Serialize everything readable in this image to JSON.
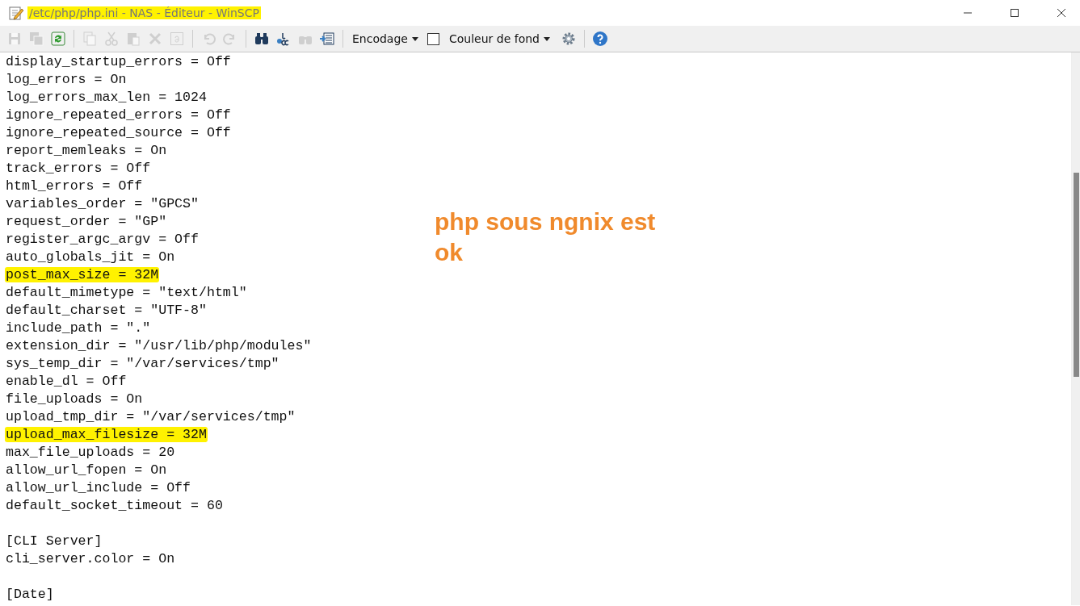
{
  "window": {
    "title": "/etc/php/php.ini - NAS - Éditeur - WinSCP",
    "title_highlighted": true
  },
  "toolbar": [
    {
      "kind": "icon",
      "disabled": true
    },
    {
      "kind": "icon",
      "disabled": true
    },
    {
      "kind": "icon",
      "disabled": false
    },
    {
      "kind": "separator"
    },
    {
      "kind": "icon",
      "disabled": true
    },
    {
      "kind": "icon",
      "disabled": true
    },
    {
      "kind": "icon",
      "disabled": true
    },
    {
      "kind": "icon",
      "disabled": true
    },
    {
      "kind": "icon",
      "disabled": true
    },
    {
      "kind": "separator"
    },
    {
      "kind": "icon",
      "disabled": true
    },
    {
      "kind": "icon",
      "disabled": true
    },
    {
      "kind": "separator"
    },
    {
      "kind": "icon",
      "disabled": false
    },
    {
      "kind": "icon",
      "disabled": false
    },
    {
      "kind": "icon",
      "disabled": true
    },
    {
      "kind": "icon",
      "disabled": false
    },
    {
      "kind": "separator"
    },
    {
      "kind": "dropdown",
      "label": "Encodage"
    },
    {
      "kind": "checkbox",
      "label": "Couleur de fond",
      "checked": false
    },
    {
      "kind": "icon",
      "disabled": false
    },
    {
      "kind": "separator"
    },
    {
      "kind": "icon",
      "disabled": false
    }
  ],
  "lines": [
    {
      "kind": "code",
      "text": "display_startup_errors = Off",
      "highlighted": false
    },
    {
      "kind": "code",
      "text": "log_errors = On",
      "highlighted": false
    },
    {
      "kind": "code",
      "text": "log_errors_max_len = 1024",
      "highlighted": false
    },
    {
      "kind": "code",
      "text": "ignore_repeated_errors = Off",
      "highlighted": false
    },
    {
      "kind": "code",
      "text": "ignore_repeated_source = Off",
      "highlighted": false
    },
    {
      "kind": "code",
      "text": "report_memleaks = On",
      "highlighted": false
    },
    {
      "kind": "code",
      "text": "track_errors = Off",
      "highlighted": false
    },
    {
      "kind": "code",
      "text": "html_errors = Off",
      "highlighted": false
    },
    {
      "kind": "code",
      "text": "variables_order = \"GPCS\"",
      "highlighted": false
    },
    {
      "kind": "code",
      "text": "request_order = \"GP\"",
      "highlighted": false
    },
    {
      "kind": "code",
      "text": "register_argc_argv = Off",
      "highlighted": false
    },
    {
      "kind": "code",
      "text": "auto_globals_jit = On",
      "highlighted": false
    },
    {
      "kind": "code",
      "text": "post_max_size = 32M",
      "highlighted": true
    },
    {
      "kind": "code",
      "text": "default_mimetype = \"text/html\"",
      "highlighted": false
    },
    {
      "kind": "code",
      "text": "default_charset = \"UTF-8\"",
      "highlighted": false
    },
    {
      "kind": "code",
      "text": "include_path = \".\"",
      "highlighted": false
    },
    {
      "kind": "code",
      "text": "extension_dir = \"/usr/lib/php/modules\"",
      "highlighted": false
    },
    {
      "kind": "code",
      "text": "sys_temp_dir = \"/var/services/tmp\"",
      "highlighted": false
    },
    {
      "kind": "code",
      "text": "enable_dl = Off",
      "highlighted": false
    },
    {
      "kind": "code",
      "text": "file_uploads = On",
      "highlighted": false
    },
    {
      "kind": "code",
      "text": "upload_tmp_dir = \"/var/services/tmp\"",
      "highlighted": false
    },
    {
      "kind": "code",
      "text": "upload_max_filesize = 32M",
      "highlighted": true
    },
    {
      "kind": "code",
      "text": "max_file_uploads = 20",
      "highlighted": false
    },
    {
      "kind": "code",
      "text": "allow_url_fopen = On",
      "highlighted": false
    },
    {
      "kind": "code",
      "text": "allow_url_include = Off",
      "highlighted": false
    },
    {
      "kind": "code",
      "text": "default_socket_timeout = 60",
      "highlighted": false
    },
    {
      "kind": "blank"
    },
    {
      "kind": "code",
      "text": "[CLI Server]",
      "highlighted": false
    },
    {
      "kind": "code",
      "text": "cli_server.color = On",
      "highlighted": false
    },
    {
      "kind": "blank"
    },
    {
      "kind": "code",
      "text": "[Date]",
      "highlighted": false
    }
  ],
  "annotation": {
    "text": "php sous ngnix est ok"
  }
}
